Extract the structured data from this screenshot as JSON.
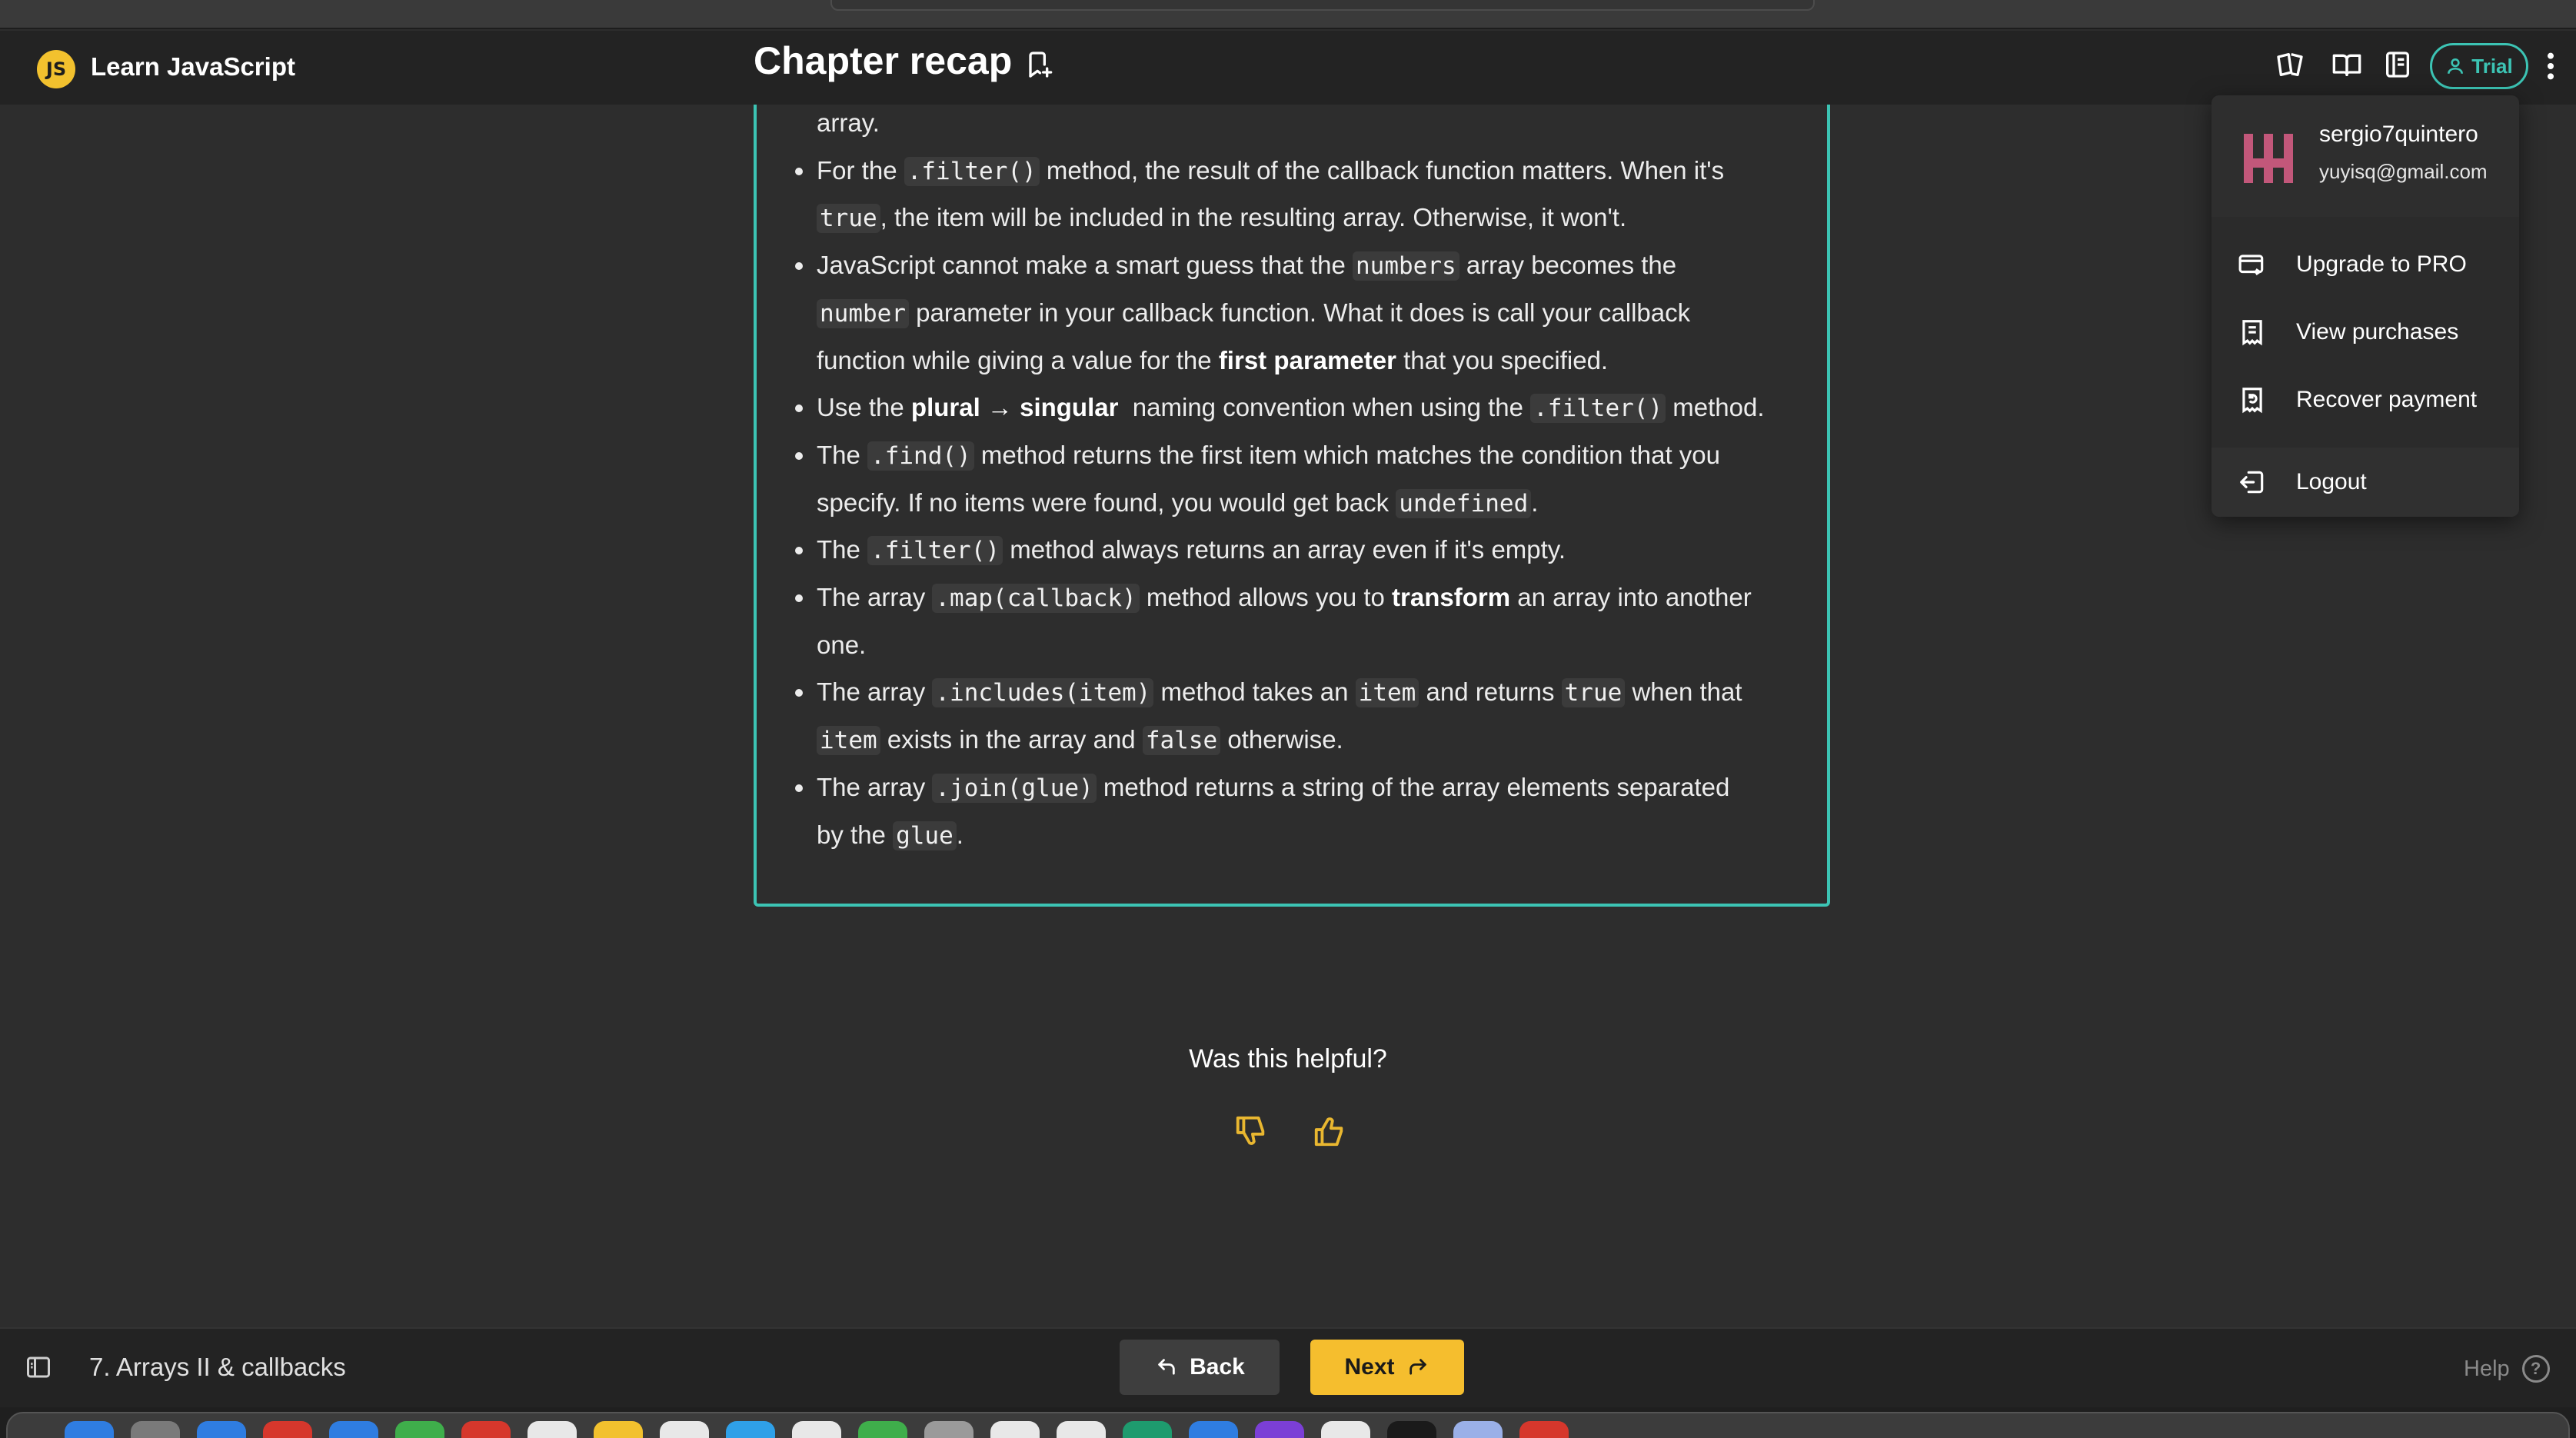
{
  "app": {
    "logo_text": "JS",
    "name": "Learn JavaScript"
  },
  "header": {
    "title": "Chapter recap",
    "trial_label": "Trial"
  },
  "recap_items": [
    {
      "lines": [
        [
          "array."
        ]
      ]
    },
    {
      "lines": [
        [
          "For the ",
          {
            "code": ".filter()"
          },
          " method, the result of the callback function matters. When it's"
        ],
        [
          {
            "code": "true"
          },
          ", the item will be included in the resulting array. Otherwise, it won't."
        ]
      ]
    },
    {
      "lines": [
        [
          "JavaScript cannot make a smart guess that the ",
          {
            "code": "numbers"
          },
          " array becomes the"
        ],
        [
          {
            "code": "number"
          },
          " parameter in your callback function. What it does is call your callback"
        ],
        [
          "function while giving a value for the ",
          {
            "bold": "first parameter"
          },
          " that you specified."
        ]
      ]
    },
    {
      "lines": [
        [
          "Use the ",
          {
            "bold": "plural → singular"
          },
          "  naming convention when using the ",
          {
            "code": ".filter()"
          },
          " method."
        ]
      ]
    },
    {
      "lines": [
        [
          "The ",
          {
            "code": ".find()"
          },
          " method returns the first item which matches the condition that you"
        ],
        [
          "specify. If no items were found, you would get back ",
          {
            "code": "undefined"
          },
          "."
        ]
      ]
    },
    {
      "lines": [
        [
          "The ",
          {
            "code": ".filter()"
          },
          " method always returns an array even if it's empty."
        ]
      ]
    },
    {
      "lines": [
        [
          "The array ",
          {
            "code": ".map(callback)"
          },
          " method allows you to ",
          {
            "bold": "transform"
          },
          " an array into another"
        ],
        [
          "one."
        ]
      ]
    },
    {
      "lines": [
        [
          "The array ",
          {
            "code": ".includes(item)"
          },
          " method takes an ",
          {
            "code": "item"
          },
          " and returns ",
          {
            "code": "true"
          },
          " when that"
        ],
        [
          {
            "code": "item"
          },
          " exists in the array and ",
          {
            "code": "false"
          },
          " otherwise."
        ]
      ]
    },
    {
      "lines": [
        [
          "The array ",
          {
            "code": ".join(glue)"
          },
          " method returns a string of the array elements separated"
        ],
        [
          "by the ",
          {
            "code": "glue"
          },
          "."
        ]
      ]
    }
  ],
  "feedback": {
    "question": "Was this helpful?"
  },
  "footer": {
    "chapter": "7. Arrays II & callbacks",
    "back_label": "Back",
    "next_label": "Next",
    "help_label": "Help"
  },
  "user_menu": {
    "username": "sergio7quintero",
    "email": "yuyisq@gmail.com",
    "items": [
      {
        "label": "Upgrade to PRO",
        "icon": "upgrade-card-icon"
      },
      {
        "label": "View purchases",
        "icon": "receipt-icon"
      },
      {
        "label": "Recover payment",
        "icon": "recover-receipt-icon"
      },
      {
        "label": "Logout",
        "icon": "logout-icon"
      }
    ]
  },
  "colors": {
    "accent": "#3cc4b4",
    "primary_button": "#f5be2e",
    "thumb_icons": "#e9b730",
    "background": "#2d2d2d"
  }
}
